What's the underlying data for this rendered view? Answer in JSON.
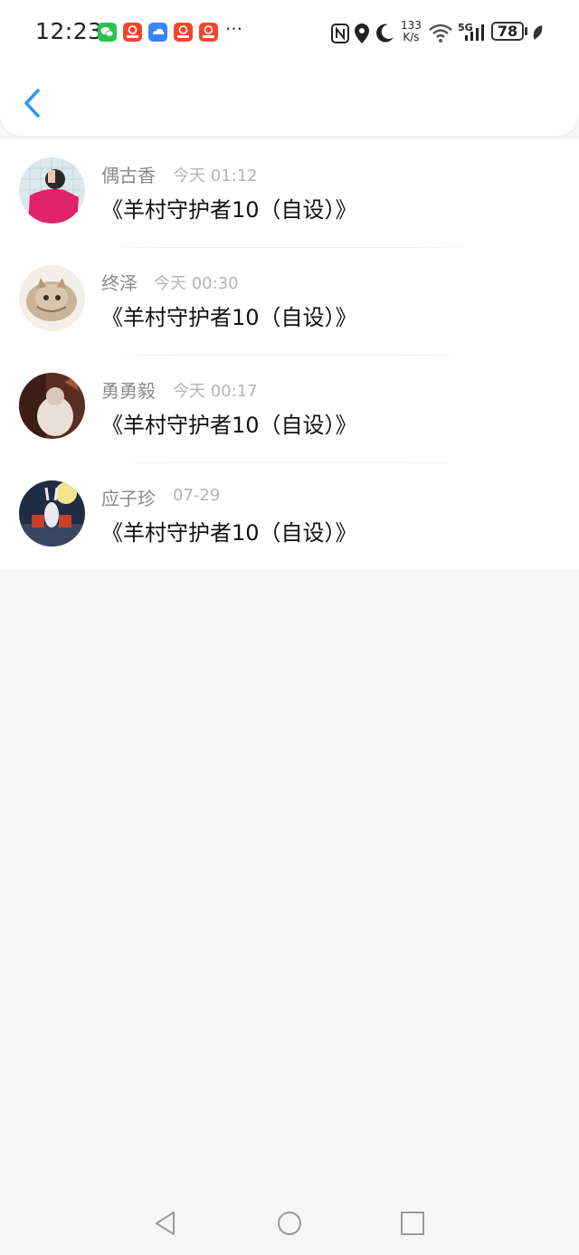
{
  "status_bar": {
    "time": "12:23",
    "net_speed_value": "133",
    "net_speed_unit": "K/s",
    "network": "5G",
    "battery": "78",
    "app_icons": [
      "wechat-icon",
      "red-app-icon",
      "cloud-icon",
      "red-app-icon",
      "red-app-icon"
    ],
    "more": "···"
  },
  "header": {
    "back_icon": "chevron-left-icon",
    "accent_color": "#2b9af3"
  },
  "list": {
    "items": [
      {
        "name": "偶古香",
        "time": "今天 01:12",
        "message": "《羊村守护者10（自设）》",
        "avatar": "avatar-pink-shirt"
      },
      {
        "name": "终泽",
        "time": "今天 00:30",
        "message": "《羊村守护者10（自设）》",
        "avatar": "avatar-kitten"
      },
      {
        "name": "勇勇毅",
        "time": "今天 00:17",
        "message": "《羊村守护者10（自设）》",
        "avatar": "avatar-photo"
      },
      {
        "name": "应子珍",
        "time": "07-29",
        "message": "《羊村守护者10（自设）》",
        "avatar": "avatar-rabbit-moon"
      }
    ]
  },
  "nav_bar": {
    "back_icon": "triangle-back-icon",
    "home_icon": "circle-home-icon",
    "recents_icon": "square-recents-icon"
  }
}
